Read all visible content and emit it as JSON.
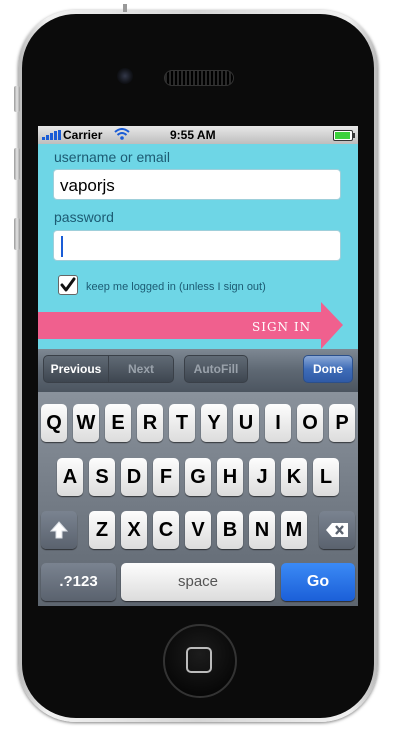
{
  "status_bar": {
    "carrier": "Carrier",
    "time": "9:55 AM"
  },
  "form": {
    "username_label": "username or email",
    "username_value": "vaporjs",
    "password_label": "password",
    "password_value": "",
    "keep_logged_in_label": "keep me logged in (unless I sign out)",
    "keep_logged_in_checked": true,
    "sign_in_label": "SIGN IN"
  },
  "colors": {
    "background": "#6ed6e6",
    "sign_in_arrow": "#f0608e",
    "go_key": "#2a6ff0",
    "label_text": "#1c5b73"
  },
  "accessory_bar": {
    "previous": "Previous",
    "next": "Next",
    "autofill": "AutoFill",
    "done": "Done"
  },
  "keyboard": {
    "row1": [
      "Q",
      "W",
      "E",
      "R",
      "T",
      "Y",
      "U",
      "I",
      "O",
      "P"
    ],
    "row2": [
      "A",
      "S",
      "D",
      "F",
      "G",
      "H",
      "J",
      "K",
      "L"
    ],
    "row3": [
      "Z",
      "X",
      "C",
      "V",
      "B",
      "N",
      "M"
    ],
    "shift_icon": "shift-arrow-icon",
    "backspace_icon": "backspace-icon",
    "numbers_key": ".?123",
    "space_key": "space",
    "go_key": "Go"
  }
}
